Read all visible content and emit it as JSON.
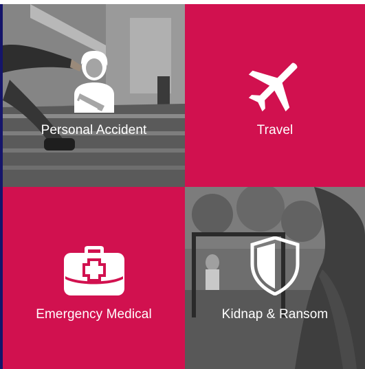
{
  "tiles": [
    {
      "label": "Personal Accident",
      "icon": "injured-person-icon"
    },
    {
      "label": "Travel",
      "icon": "airplane-icon"
    },
    {
      "label": "Emergency Medical",
      "icon": "first-aid-kit-icon"
    },
    {
      "label": "Kidnap & Ransom",
      "icon": "shield-icon"
    }
  ],
  "colors": {
    "accent": "#d1114f",
    "background": "#15156a",
    "text": "#ffffff"
  }
}
